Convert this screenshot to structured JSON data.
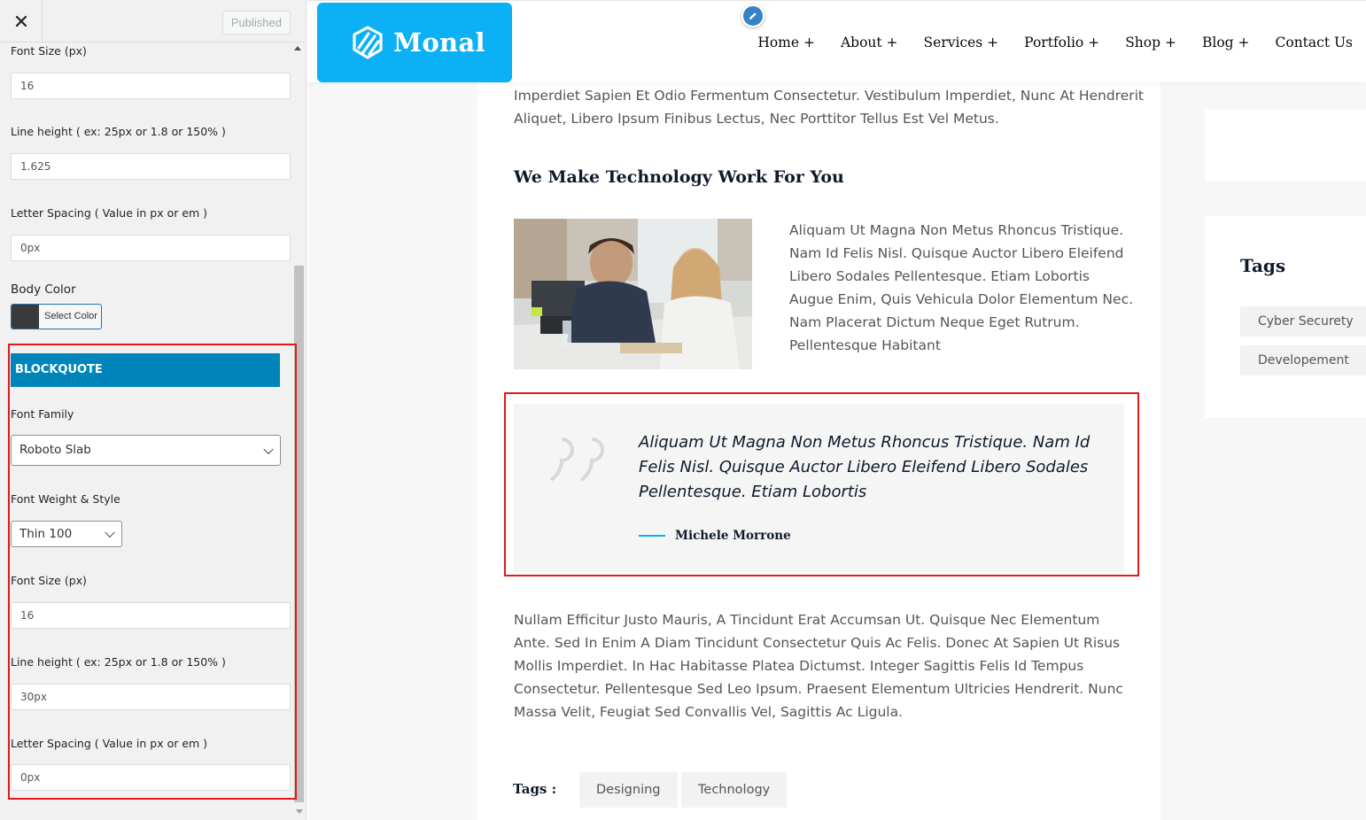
{
  "customizer": {
    "publish_label": "Published",
    "fields": {
      "body_font_size_label": "Font Size (px)",
      "body_font_size_value": "16",
      "body_line_height_label": "Line height ( ex: 25px or 1.8 or 150% )",
      "body_line_height_value": "1.625",
      "body_letter_spacing_label": "Letter Spacing ( Value in px or em )",
      "body_letter_spacing_value": "0px",
      "body_color_label": "Body Color",
      "select_color_label": "Select Color",
      "body_color_value": "#3a3a3a"
    },
    "blockquote": {
      "heading": "BLOCKQUOTE",
      "font_family_label": "Font Family",
      "font_family_value": "Roboto Slab",
      "font_weight_label": "Font Weight & Style",
      "font_weight_value": "Thin 100",
      "font_size_label": "Font Size (px)",
      "font_size_value": "16",
      "line_height_label": "Line height ( ex: 25px or 1.8 or 150% )",
      "line_height_value": "30px",
      "letter_spacing_label": "Letter Spacing ( Value in px or em )",
      "letter_spacing_value": "0px"
    },
    "accent_color": "#0085ba",
    "highlight_color": "#e01919"
  },
  "site": {
    "logo_text": "Monal",
    "brand_color": "#0cb0f5",
    "nav": [
      "Home +",
      "About +",
      "Services +",
      "Portfolio +",
      "Shop +",
      "Blog +",
      "Contact Us"
    ]
  },
  "post": {
    "intro_lines": [
      "Imperdiet Sapien Et Odio Fermentum Consectetur. Vestibulum Imperdiet, Nunc At Hendrerit",
      "Aliquet, Libero Ipsum Finibus Lectus, Nec Porttitor Tellus Est Vel Metus."
    ],
    "section_title": "We Make Technology Work For You",
    "side_text_lines": [
      "Aliquam Ut Magna Non Metus Rhoncus Tristique.",
      "Nam Id Felis Nisl. Quisque Auctor Libero Eleifend",
      "Libero Sodales Pellentesque. Etiam Lobortis",
      "Augue Enim, Quis Vehicula Dolor Elementum Nec.",
      "Nam Placerat Dictum Neque Eget Rutrum.",
      "Pellentesque Habitant"
    ],
    "quote_lines": [
      "Aliquam Ut Magna Non Metus Rhoncus Tristique. Nam Id",
      "Felis Nisl. Quisque Auctor Libero Eleifend Libero Sodales",
      "Pellentesque. Etiam Lobortis"
    ],
    "quote_author": "Michele Morrone",
    "outro_lines": [
      "Nullam Efficitur Justo Mauris, A Tincidunt Erat Accumsan Ut. Quisque Nec Elementum",
      "Ante. Sed In Enim A Diam Tincidunt Consectetur Quis Ac Felis. Donec At Sapien Ut Risus",
      "Mollis Imperdiet. In Hac Habitasse Platea Dictumst. Integer Sagittis Felis Id Tempus",
      "Consectetur. Pellentesque Sed Leo Ipsum. Praesent Elementum Ultricies Hendrerit. Nunc",
      "Massa Velit, Feugiat Sed Convallis Vel, Sagittis Ac Ligula."
    ],
    "tags_label": "Tags :",
    "tags": [
      "Designing",
      "Technology"
    ]
  },
  "sidebar": {
    "tags_title": "Tags",
    "tags": [
      "Cyber Securety",
      "Developement"
    ]
  }
}
